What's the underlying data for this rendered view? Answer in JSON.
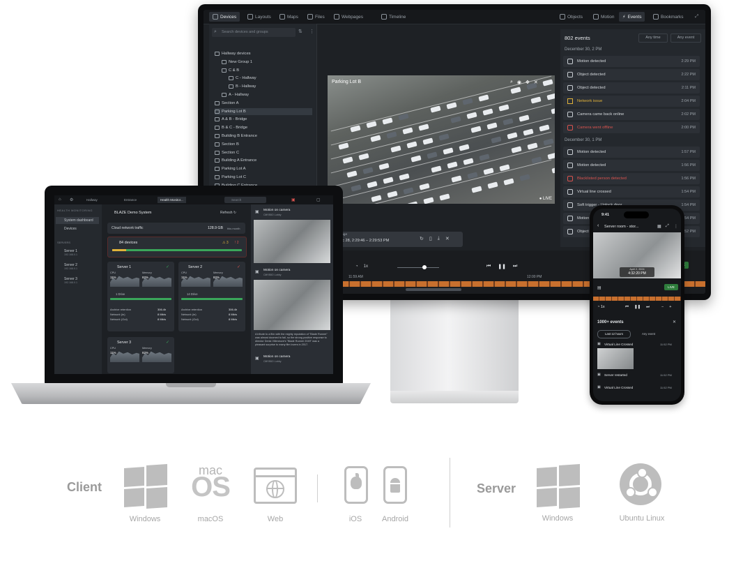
{
  "monitor": {
    "tabs": [
      "Devices",
      "Layouts",
      "Maps",
      "Files",
      "Webpages",
      "Timeline"
    ],
    "right_tabs": [
      "Objects",
      "Motion",
      "Events",
      "Bookmarks"
    ],
    "search_placeholder": "Search devices and groups",
    "tree": [
      {
        "label": "Hallway devices",
        "indent": 0
      },
      {
        "label": "New Group 1",
        "indent": 1
      },
      {
        "label": "C & B",
        "indent": 1
      },
      {
        "label": "C - Hallway",
        "indent": 2
      },
      {
        "label": "B - Hallway",
        "indent": 2
      },
      {
        "label": "A - Hallway",
        "indent": 1
      },
      {
        "label": "Section A",
        "indent": 0
      },
      {
        "label": "Parking Lot B",
        "indent": 0,
        "selected": true
      },
      {
        "label": "A & B - Bridge",
        "indent": 0
      },
      {
        "label": "B & C - Bridge",
        "indent": 0
      },
      {
        "label": "Building B Entrance",
        "indent": 0
      },
      {
        "label": "Section B",
        "indent": 0
      },
      {
        "label": "Section C",
        "indent": 0
      },
      {
        "label": "Building A Entrance",
        "indent": 0
      },
      {
        "label": "Parking Lot A",
        "indent": 0
      },
      {
        "label": "Parking Lot C",
        "indent": 0
      },
      {
        "label": "Building C Entrance",
        "indent": 0
      }
    ],
    "video_title": "Parking Lot B",
    "live_label": "LIVE",
    "events": {
      "count": "802 events",
      "filter_a": "Any time",
      "filter_b": "Any event",
      "groups": [
        {
          "date": "December 30,  2 PM",
          "items": [
            {
              "name": "Motion detected",
              "time": "2:29 PM",
              "kind": "normal"
            },
            {
              "name": "Object detected",
              "time": "2:22 PM",
              "kind": "normal"
            },
            {
              "name": "Object detected",
              "time": "2:11 PM",
              "kind": "normal"
            },
            {
              "name": "Network issue",
              "time": "2:04 PM",
              "kind": "warn"
            },
            {
              "name": "Camera came back online",
              "time": "2:02 PM",
              "kind": "normal"
            },
            {
              "name": "Camera went offline",
              "time": "2:00 PM",
              "kind": "err"
            }
          ]
        },
        {
          "date": "December 30,  1 PM",
          "items": [
            {
              "name": "Motion detected",
              "time": "1:57 PM",
              "kind": "normal"
            },
            {
              "name": "Motion detected",
              "time": "1:56 PM",
              "kind": "normal"
            },
            {
              "name": "Blacklisted person detected",
              "time": "1:56 PM",
              "kind": "err"
            },
            {
              "name": "Virtual line crossed",
              "time": "1:54 PM",
              "kind": "normal"
            },
            {
              "name": "Soft trigger - Unlock door",
              "time": "1:54 PM",
              "kind": "normal"
            },
            {
              "name": "Motion detected",
              "time": "1:54 PM",
              "kind": "normal"
            },
            {
              "name": "Object detected",
              "time": "1:52 PM",
              "kind": "normal"
            }
          ]
        }
      ]
    },
    "range_label": "Range",
    "range_value": "Dec 28, 2:29:46 – 2:29:53 PM",
    "timeline_left": "11:59 AM",
    "timeline_mid": "12:00 PM",
    "live_btn": "LIVE"
  },
  "laptop": {
    "tabs": [
      "Hallway",
      "Entrance",
      "Health Monitor..."
    ],
    "search": "Search",
    "side_head": "HEALTH MONITORING",
    "side_items": [
      "System dashboard",
      "Devices"
    ],
    "servers_head": "SERVERS",
    "servers": [
      {
        "name": "Server 1",
        "ip": "192.168.0.1"
      },
      {
        "name": "Server 2",
        "ip": "192.168.0.1"
      },
      {
        "name": "Server 3",
        "ip": "192.168.0.1"
      }
    ],
    "system_name": "BLAZE Demo System",
    "refresh": "Refresh",
    "traffic_label": "Cloud network traffic",
    "traffic_value": "128.9 GB",
    "traffic_unit": "this month",
    "devices_label": "84 devices",
    "devices_warn": "3",
    "devices_err": "2",
    "server_cards": [
      {
        "name": "Server 1",
        "cpu": "CPU",
        "cpu_val": "11%",
        "mem": "Memory",
        "mem_val": "82%",
        "drives": "1 Drive",
        "ret_label": "Archive retention",
        "ret_val": "306.4h",
        "in_label": "Network (in)",
        "in_val": "8 Mb/s",
        "out_label": "Network (Out)",
        "out_val": "8 Mb/s"
      },
      {
        "name": "Server 2",
        "cpu": "CPU",
        "cpu_val": "11%",
        "mem": "Memory",
        "mem_val": "82%",
        "drives": "14 Drive",
        "ret_label": "Archive retention",
        "ret_val": "306.4h",
        "in_label": "Network (in)",
        "in_val": "8 Mb/s",
        "out_label": "Network (Out)",
        "out_val": "8 Mb/s"
      },
      {
        "name": "Server 3",
        "cpu": "CPU",
        "cpu_val": "11%",
        "mem": "Memory",
        "mem_val": "82%"
      }
    ],
    "feed": [
      {
        "title": "Motion on camera",
        "sub": "Cliff BBO Lobby"
      },
      {
        "title": "Motion on camera",
        "sub": "Cliff BBO Lobby"
      },
      {
        "title": "Motion on camera",
        "sub": "Cliff BBO Lobby"
      }
    ],
    "feed_note": "A tribute to a film with the mighty reputation of \"Blade Runner\" was almost doomed to fail, so the strong positive response to director Denis Villeneuve's \"Blade Runner 2049\" was a pleasant surprise to many film lovers in 2017."
  },
  "phone": {
    "time": "9:41",
    "title": "Server room - stor...",
    "video_date": "April 2, 2024",
    "video_time": "4:32:20 PM",
    "live": "LIVE",
    "speed": "1x",
    "events_count": "1000+ events",
    "filter_a": "Last 12 hours",
    "filter_b": "Any event",
    "events": [
      {
        "name": "Virtual Line Crossed",
        "time": "11:52 PM"
      },
      {
        "name": "Server restarted",
        "time": "11:52 PM"
      },
      {
        "name": "Virtual Line Crossed",
        "time": "11:52 PM"
      }
    ]
  },
  "platforms": {
    "client_head": "Client",
    "server_head": "Server",
    "macos_top": "mac",
    "macos_big": "OS",
    "client_items": [
      "Windows",
      "macOS",
      "Web",
      "iOS",
      "Android"
    ],
    "server_items": [
      "Windows",
      "Ubuntu Linux"
    ]
  },
  "colors": {
    "accent_green": "#3aa65a",
    "warn": "#e0b23a",
    "error": "#d9534f",
    "icon_gray": "#bdbdbd"
  }
}
